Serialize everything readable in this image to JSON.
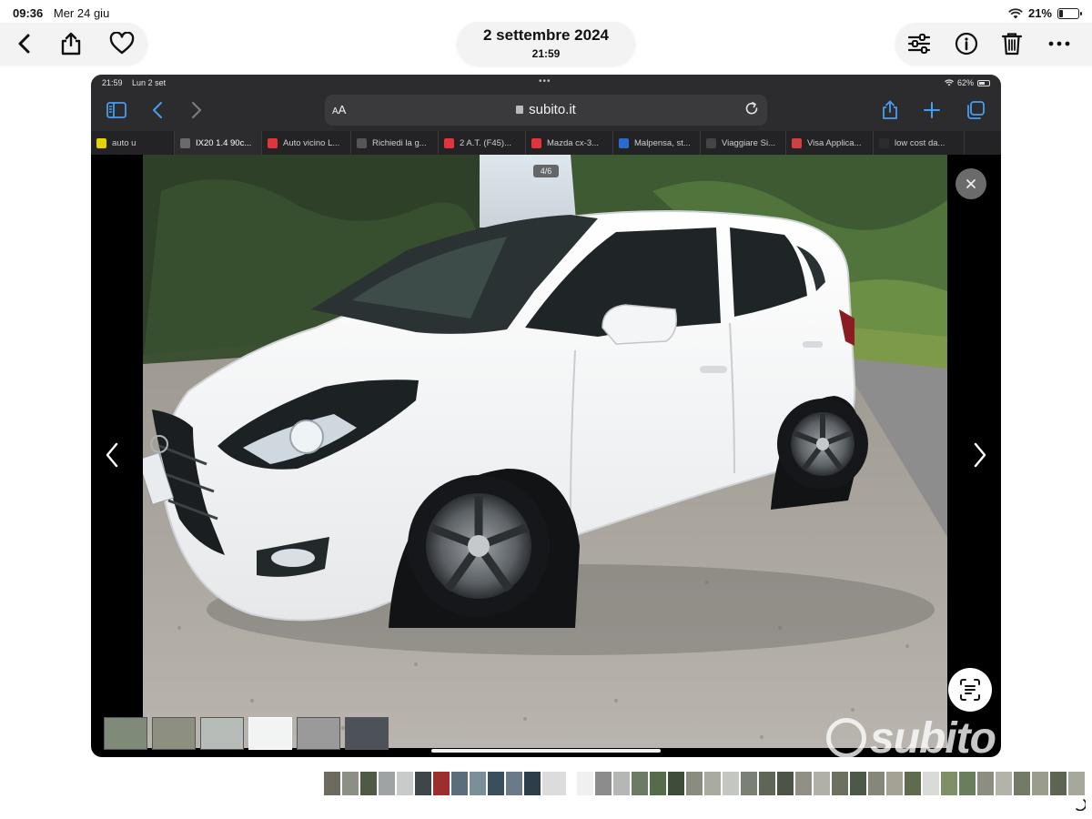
{
  "device_status": {
    "time": "09:36",
    "date": "Mer 24 giu",
    "battery_percent": 21,
    "battery_label": "21%"
  },
  "photos_toolbar": {
    "back_icon": "chevron-left-icon",
    "share_icon": "share-icon",
    "favorite_icon": "heart-icon",
    "title": "2 settembre 2024",
    "time": "21:59",
    "adjust_icon": "sliders-icon",
    "info_icon": "info-icon",
    "delete_icon": "trash-icon",
    "more_icon": "ellipsis-icon"
  },
  "screenshot": {
    "status": {
      "time": "21:59",
      "date": "Lun 2 set",
      "battery_percent": 62,
      "battery_label": "62%"
    },
    "safari": {
      "url_text_size_label": "AA",
      "url_host": "subito.it",
      "tabs": [
        {
          "title": "auto u",
          "favicon_color": "#e3d400"
        },
        {
          "title": "IX20 1.4 90c...",
          "favicon_color": "#6a6a6a",
          "active": true
        },
        {
          "title": "Auto vicino L...",
          "favicon_color": "#e0353b"
        },
        {
          "title": "Richiedi la g...",
          "favicon_color": "#555555"
        },
        {
          "title": "2 A.T. (F45)...",
          "favicon_color": "#e0353b"
        },
        {
          "title": "Mazda cx-3...",
          "favicon_color": "#e0353b"
        },
        {
          "title": "Malpensa, st...",
          "favicon_color": "#2d6ad0"
        },
        {
          "title": "Viaggiare Si...",
          "favicon_color": "#444444"
        },
        {
          "title": "Visa Applica...",
          "favicon_color": "#d04040"
        },
        {
          "title": "low cost da...",
          "favicon_color": "#2c2c2e"
        }
      ]
    },
    "gallery": {
      "counter": "4/6",
      "close_icon": "close-icon",
      "prev_icon": "chevron-left-icon",
      "next_icon": "chevron-right-icon",
      "livetext_icon": "live-text-icon",
      "thumbnails": 6,
      "current_thumbnail": 4
    },
    "watermark": "subito"
  },
  "colors": {
    "accent_blue": "#4a9cf0",
    "toolbar_bg": "#f3f3f3",
    "safari_bg": "#2c2c2e",
    "brand_red": "#e0353b"
  }
}
